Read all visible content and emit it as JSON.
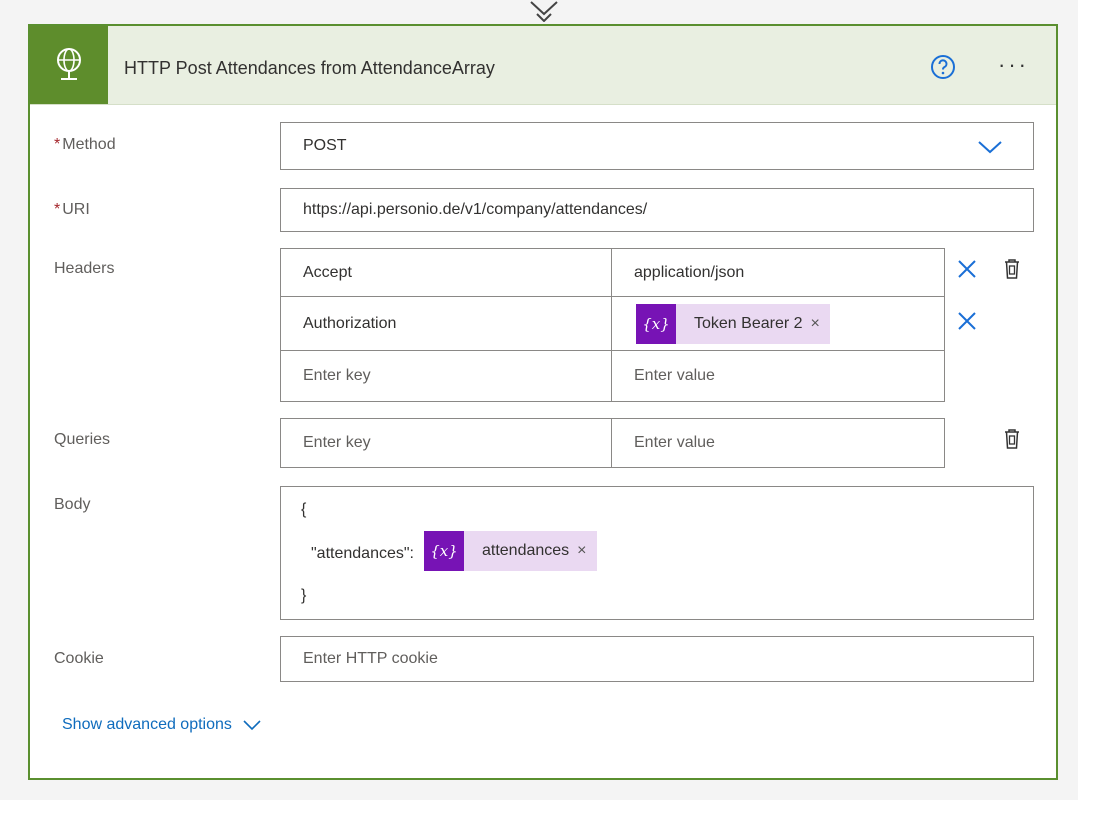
{
  "card": {
    "title": "HTTP Post Attendances from AttendanceArray",
    "accent_color": "#5e8d2c",
    "header_icon": "globe-icon",
    "help_icon": "help-circle-icon",
    "more_icon": "more-ellipsis-icon",
    "more_label": "···"
  },
  "method": {
    "label": "Method",
    "required_mark": "*",
    "value": "POST"
  },
  "uri": {
    "label": "URI",
    "required_mark": "*",
    "value": "https://api.personio.de/v1/company/attendances/"
  },
  "headers": {
    "label": "Headers",
    "rows": [
      {
        "key": "Accept",
        "value": "application/json"
      },
      {
        "key": "Authorization",
        "token": {
          "icon_text": "{x}",
          "label": "Token Bearer 2",
          "remove": "×"
        }
      }
    ],
    "key_placeholder": "Enter key",
    "value_placeholder": "Enter value"
  },
  "queries": {
    "label": "Queries",
    "key_placeholder": "Enter key",
    "value_placeholder": "Enter value"
  },
  "body": {
    "label": "Body",
    "open_brace": "{",
    "field_name": "\"attendances\":",
    "token": {
      "icon_text": "{x}",
      "label": "attendances",
      "remove": "×"
    },
    "close_brace": "}"
  },
  "cookie": {
    "label": "Cookie",
    "placeholder": "Enter HTTP cookie"
  },
  "advanced": {
    "label": "Show advanced options"
  }
}
